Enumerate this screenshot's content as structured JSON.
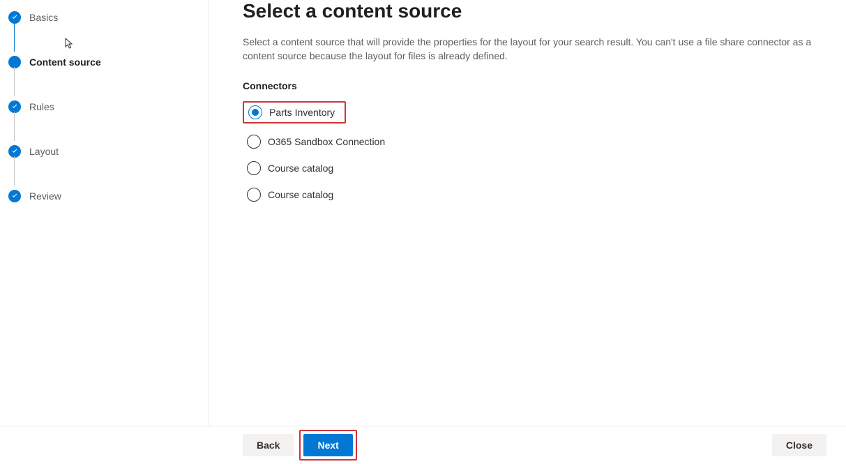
{
  "sidebar": {
    "steps": [
      {
        "label": "Basics",
        "state": "completed"
      },
      {
        "label": "Content source",
        "state": "current"
      },
      {
        "label": "Rules",
        "state": "completed"
      },
      {
        "label": "Layout",
        "state": "completed"
      },
      {
        "label": "Review",
        "state": "completed"
      }
    ]
  },
  "main": {
    "title": "Select a content source",
    "description": "Select a content source that will provide the properties for the layout for your search result. You can't use a file share connector as a content source because the layout for files is already defined.",
    "connectors_label": "Connectors",
    "connectors": [
      {
        "label": "Parts Inventory",
        "selected": true,
        "highlighted": true
      },
      {
        "label": "O365 Sandbox Connection",
        "selected": false,
        "highlighted": false
      },
      {
        "label": "Course catalog",
        "selected": false,
        "highlighted": false
      },
      {
        "label": "Course catalog",
        "selected": false,
        "highlighted": false
      }
    ]
  },
  "footer": {
    "back_label": "Back",
    "next_label": "Next",
    "close_label": "Close",
    "next_highlighted": true
  },
  "colors": {
    "primary": "#0078d4",
    "highlight": "#d13438"
  }
}
